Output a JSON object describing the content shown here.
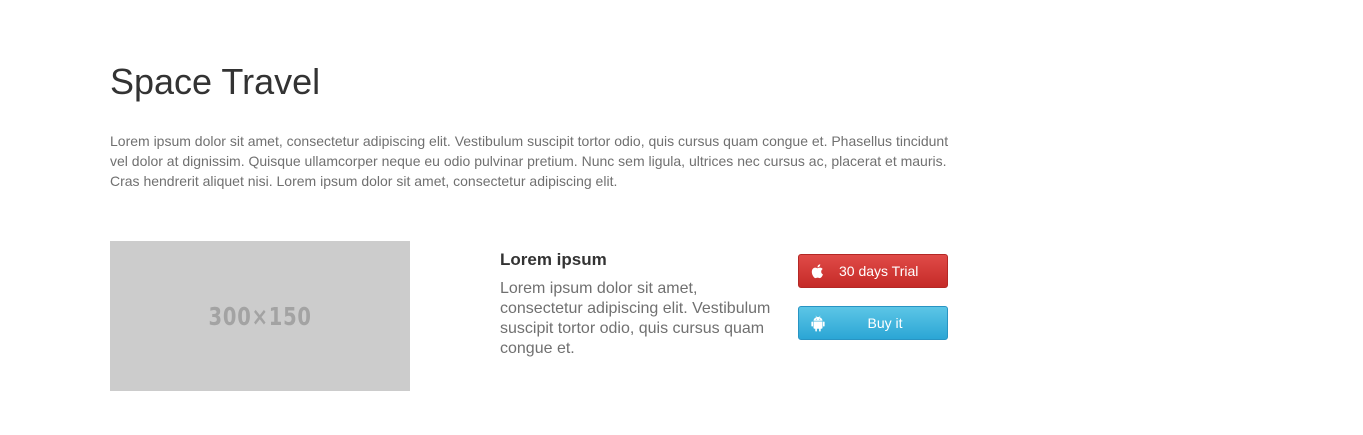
{
  "page": {
    "title": "Space Travel",
    "intro": "Lorem ipsum dolor sit amet, consectetur adipiscing elit. Vestibulum suscipit tortor odio, quis cursus quam congue et. Phasellus tincidunt vel dolor at dignissim. Quisque ullamcorper neque eu odio pulvinar pretium. Nunc sem ligula, ultrices nec cursus ac, placerat et mauris. Cras hendrerit aliquet nisi. Lorem ipsum dolor sit amet, consectetur adipiscing elit."
  },
  "feature": {
    "image_label": "300×150",
    "title": "Lorem ipsum",
    "text": "Lorem ipsum dolor sit amet, consectetur adipiscing elit. Vestibulum suscipit tortor odio, quis cursus quam congue et."
  },
  "buttons": {
    "trial": {
      "label": "30 days Trial",
      "icon": "apple-icon",
      "color": "#d0342f"
    },
    "buy": {
      "label": "Buy it",
      "icon": "android-icon",
      "color": "#3bb4dd"
    }
  },
  "colors": {
    "background": "#ffffff",
    "heading": "#333333",
    "body_text": "#707070",
    "placeholder": "#cccccc"
  }
}
